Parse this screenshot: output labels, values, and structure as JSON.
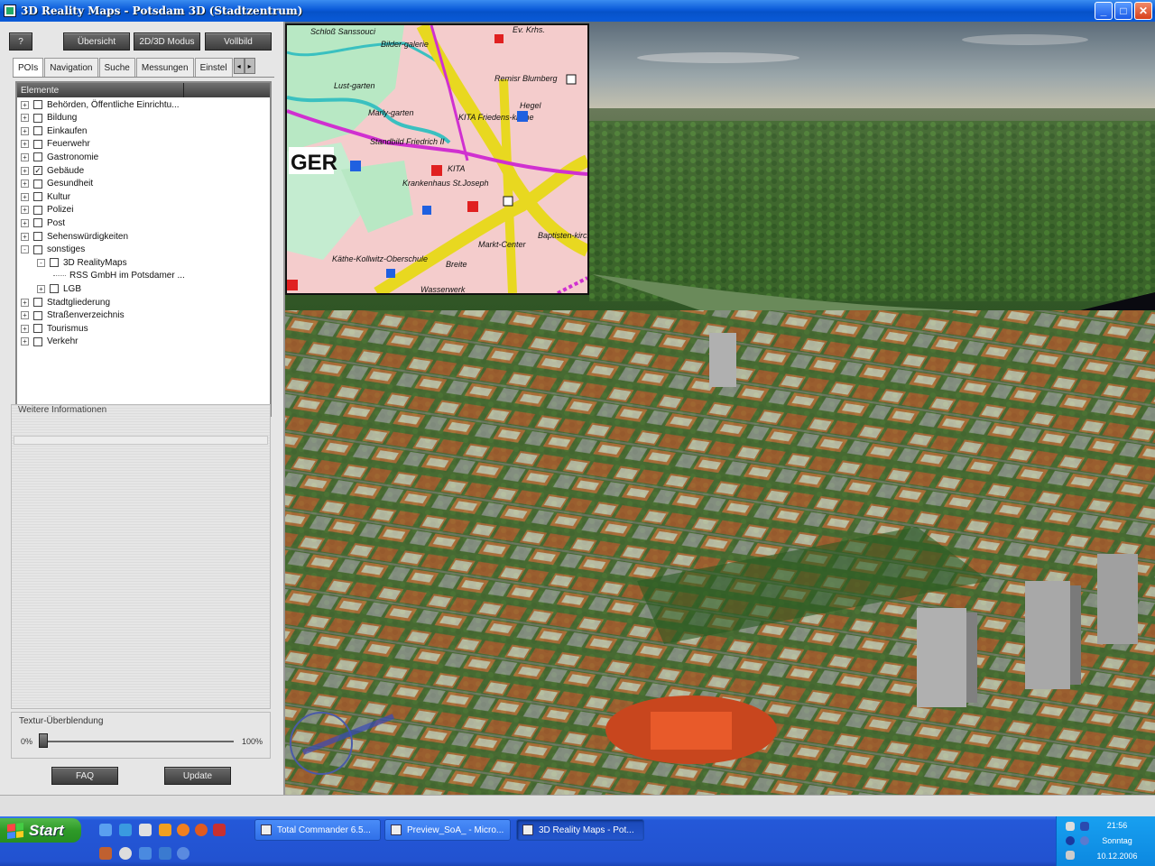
{
  "window": {
    "title": "3D Reality Maps - Potsdam 3D (Stadtzentrum)"
  },
  "window_buttons": [
    "_",
    "□",
    "✕"
  ],
  "toolbar": {
    "help": "?",
    "overview": "Übersicht",
    "mode": "2D/3D Modus",
    "fullscreen": "Vollbild"
  },
  "tabs": [
    "POIs",
    "Navigation",
    "Suche",
    "Messungen",
    "Einstel"
  ],
  "tree": {
    "header": "Elemente",
    "items": [
      {
        "label": "Behörden, Öffentliche Einrichtu...",
        "checked": false
      },
      {
        "label": "Bildung",
        "checked": false
      },
      {
        "label": "Einkaufen",
        "checked": false
      },
      {
        "label": "Feuerwehr",
        "checked": false
      },
      {
        "label": "Gastronomie",
        "checked": false
      },
      {
        "label": "Gebäude",
        "checked": true
      },
      {
        "label": "Gesundheit",
        "checked": false
      },
      {
        "label": "Kultur",
        "checked": false
      },
      {
        "label": "Polizei",
        "checked": false
      },
      {
        "label": "Post",
        "checked": false
      },
      {
        "label": "Sehenswürdigkeiten",
        "checked": false
      },
      {
        "label": "sonstiges",
        "checked": false
      },
      {
        "label": "3D RealityMaps",
        "checked": false
      },
      {
        "label": "RSS GmbH im Potsdamer ...",
        "checked": false
      },
      {
        "label": "LGB",
        "checked": false
      },
      {
        "label": "Stadtgliederung",
        "checked": false
      },
      {
        "label": "Straßenverzeichnis",
        "checked": false
      },
      {
        "label": "Tourismus",
        "checked": false
      },
      {
        "label": "Verkehr",
        "checked": false
      }
    ]
  },
  "info": {
    "label": "Weitere Informationen"
  },
  "texture": {
    "label": "Textur-Überblendung",
    "min": "0%",
    "max": "100%",
    "value_percent": 0
  },
  "actions": {
    "faq": "FAQ",
    "update": "Update"
  },
  "minimap": {
    "labels": [
      "Schloß Sanssouci",
      "Bilder-galerie",
      "Ev. Krhs.",
      "Remisr Blumberg",
      "Hegel",
      "KITA Friedens-kirche",
      "Standbild Friedrich II",
      "GER",
      "Krankenhaus St.Joseph",
      "KITA",
      "Markt-Center",
      "Baptisten-kirche",
      "Käthe-Kollwitz-Oberschule",
      "Breite",
      "Wasserwerk",
      "Lust-garten",
      "Marly-garten"
    ]
  },
  "taskbar": {
    "start": "Start",
    "items": [
      {
        "label": "Total Commander 6.5..."
      },
      {
        "label": "Preview_SoA_ - Micro..."
      },
      {
        "label": "3D Reality Maps - Pot...",
        "active": true
      }
    ],
    "clock": {
      "time": "21:56",
      "day": "Sonntag",
      "date": "10.12.2006"
    }
  },
  "colors": {
    "titlebar": "#0a5ad8",
    "taskbar": "#2252d0",
    "start": "#2e9a28",
    "tray": "#0c88e0",
    "road": "#f0e828",
    "route": "#d030d0"
  }
}
